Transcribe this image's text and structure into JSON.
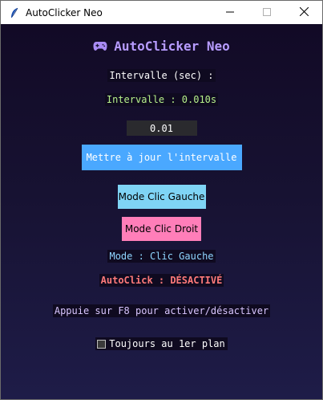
{
  "window": {
    "title": "AutoClicker Neo",
    "icons": [
      "feather-icon",
      "minimize-icon",
      "maximize-icon",
      "close-icon"
    ]
  },
  "app": {
    "title": "AutoClicker Neo",
    "title_icon": "gamepad-icon",
    "interval_label": "Intervalle (sec) :",
    "interval_display": "Intervalle : 0.010s",
    "interval_input_value": "0.01",
    "update_button": "Mettre à jour l'intervalle",
    "left_click_button": "Mode Clic Gauche",
    "right_click_button": "Mode Clic Droit",
    "mode_status": "Mode : Clic Gauche",
    "autoclick_status": "AutoClick : DÉSACTIVÉ",
    "hint": "Appuie sur F8 pour activer/désactiver",
    "always_on_top_label": "Toujours au 1er plan",
    "always_on_top_checked": false
  },
  "colors": {
    "accent_title": "#b79cff",
    "interval_value": "#b6f08a",
    "update_button_bg": "#4aa8ff",
    "left_button_bg": "#7fd4f5",
    "right_button_bg": "#ff7eb9",
    "mode_text": "#8fd6ff",
    "autoclick_off": "#ff7a7a",
    "hint_text": "#d9c6ff"
  }
}
